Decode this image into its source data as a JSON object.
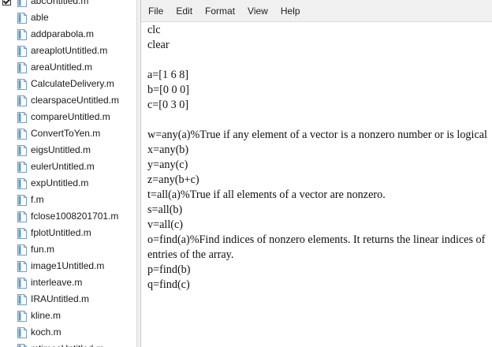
{
  "file_list": {
    "items": [
      {
        "name": "abcUntitled.m",
        "checked": true
      },
      {
        "name": "able",
        "checked": false
      },
      {
        "name": "addparabola.m",
        "checked": false
      },
      {
        "name": "areaplotUntitled.m",
        "checked": false
      },
      {
        "name": "areaUntitled.m",
        "checked": false
      },
      {
        "name": "CalculateDelivery.m",
        "checked": false
      },
      {
        "name": "clearspaceUntitled.m",
        "checked": false
      },
      {
        "name": "compareUntitled.m",
        "checked": false
      },
      {
        "name": "ConvertToYen.m",
        "checked": false
      },
      {
        "name": "eigsUntitled.m",
        "checked": false
      },
      {
        "name": "eulerUntitled.m",
        "checked": false
      },
      {
        "name": "expUntitled.m",
        "checked": false
      },
      {
        "name": "f.m",
        "checked": false
      },
      {
        "name": "fclose1008201701.m",
        "checked": false
      },
      {
        "name": "fplotUntitled.m",
        "checked": false
      },
      {
        "name": "fun.m",
        "checked": false
      },
      {
        "name": "image1Untitled.m",
        "checked": false
      },
      {
        "name": "interleave.m",
        "checked": false
      },
      {
        "name": "IRAUntitled.m",
        "checked": false
      },
      {
        "name": "kline.m",
        "checked": false
      },
      {
        "name": "koch.m",
        "checked": false
      },
      {
        "name": "mtimesUntitled.m",
        "checked": false
      }
    ]
  },
  "notepad": {
    "menu": [
      "File",
      "Edit",
      "Format",
      "View",
      "Help"
    ],
    "lines": [
      "clc",
      "clear",
      "",
      "a=[1 6 8]",
      "b=[0 0 0]",
      "c=[0 3 0]",
      "",
      "w=any(a)%True if any element of a vector is a nonzero number or is logical",
      "x=any(b)",
      "y=any(c)",
      "z=any(b+c)",
      "t=all(a)%True if all elements of a vector are nonzero.",
      "s=all(b)",
      "v=all(c)",
      "o=find(a)%Find indices of nonzero elements. It returns the linear indices of",
      "entries of the array.",
      "p=find(b)",
      "q=find(c)"
    ]
  },
  "colors": {
    "menu_bar": "#f0f0f0",
    "file_icon": "#5b9bd5",
    "text": "#111111"
  }
}
